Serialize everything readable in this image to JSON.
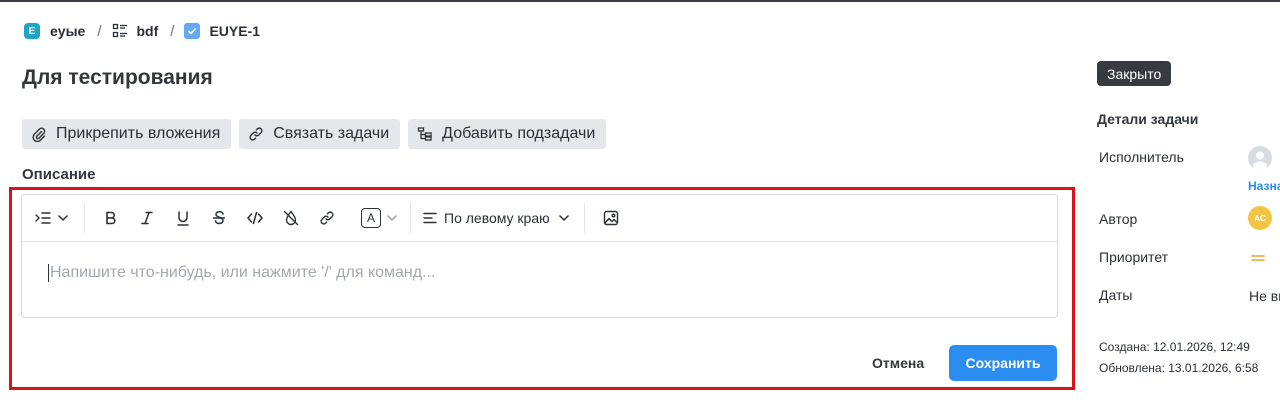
{
  "breadcrumb": {
    "project_icon_letter": "E",
    "project": "eyые",
    "board": "bdf",
    "issue": "EUYE-1",
    "separator": "/"
  },
  "issue": {
    "title": "Для тестирования"
  },
  "actions": [
    {
      "label": "Прикрепить вложения",
      "icon": "paperclip-icon"
    },
    {
      "label": "Связать задачи",
      "icon": "link-icon"
    },
    {
      "label": "Добавить подзадачи",
      "icon": "subtask-icon"
    }
  ],
  "description": {
    "label": "Описание",
    "placeholder": "Напишите что-нибудь, или нажмите '/' для команд...",
    "toolbar": {
      "text_color_letter": "A",
      "align_label": "По левому краю"
    },
    "cancel_label": "Отмена",
    "save_label": "Сохранить"
  },
  "sidebar": {
    "status": "Закрыто",
    "details_title": "Детали задачи",
    "assignee_label": "Исполнитель",
    "assign_link": "Назна",
    "author_label": "Автор",
    "author_initials": "AC",
    "priority_label": "Приоритет",
    "dates_label": "Даты",
    "dates_value": "Не вы",
    "created": "Создана: 12.01.2026, 12:49",
    "updated": "Обновлена: 13.01.2026, 6:58"
  },
  "colors": {
    "accent": "#2b8df0",
    "highlight": "#d9131c",
    "status_badge": "#373b41",
    "priority": "#f0a030",
    "author_avatar": "#f4c542",
    "project_icon": "#1fa3c9"
  }
}
